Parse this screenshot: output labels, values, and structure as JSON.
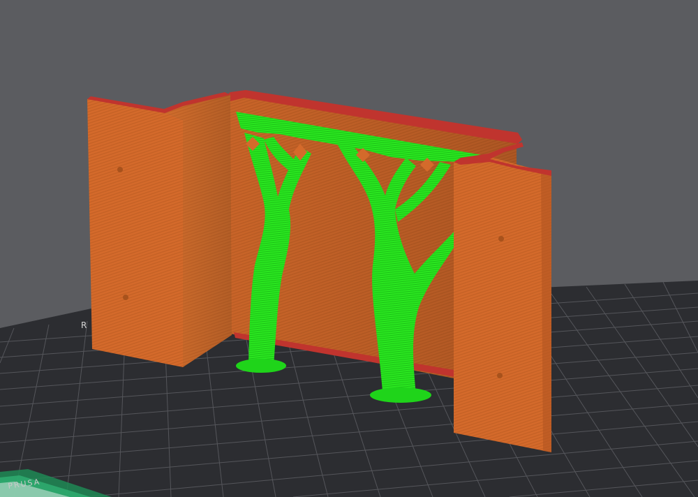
{
  "viewport": {
    "background": "#5b5c60",
    "bed_color": "#2c2d31",
    "bed_grid_color": "#5c5d62",
    "bed_edge_color": "#3a3b40"
  },
  "model": {
    "wall_color": "#d76a2a",
    "wall_shade": "#c45f24",
    "top_edge_color": "#c0342e",
    "support_color": "#22e81c",
    "support_shade": "#12b80e"
  },
  "bed": {
    "corner_text": "PRUSA",
    "side_mark": "R"
  },
  "icons": {
    "bed-logo": "bed-logo-icon"
  }
}
